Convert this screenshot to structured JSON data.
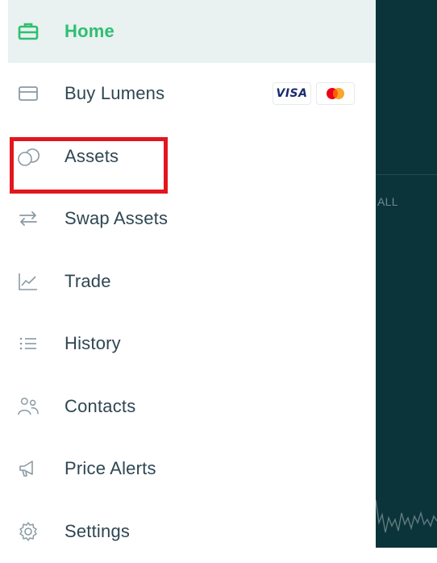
{
  "nav": {
    "items": [
      {
        "key": "home",
        "label": "Home",
        "icon": "briefcase-icon",
        "active": true
      },
      {
        "key": "buy-lumens",
        "label": "Buy Lumens",
        "icon": "card-icon",
        "active": false
      },
      {
        "key": "assets",
        "label": "Assets",
        "icon": "assets-circles-icon",
        "active": false
      },
      {
        "key": "swap-assets",
        "label": "Swap Assets",
        "icon": "swap-arrows-icon",
        "active": false
      },
      {
        "key": "trade",
        "label": "Trade",
        "icon": "line-chart-icon",
        "active": false
      },
      {
        "key": "history",
        "label": "History",
        "icon": "list-icon",
        "active": false
      },
      {
        "key": "contacts",
        "label": "Contacts",
        "icon": "contacts-icon",
        "active": false
      },
      {
        "key": "price-alerts",
        "label": "Price Alerts",
        "icon": "megaphone-icon",
        "active": false
      },
      {
        "key": "settings",
        "label": "Settings",
        "icon": "gear-icon",
        "active": false
      }
    ],
    "payment_badges": {
      "visa": "VISA",
      "mastercard": "mastercard-icon"
    }
  },
  "backdrop": {
    "range_label": "ALL"
  },
  "colors": {
    "accent": "#2fbf6f",
    "active_bg": "#e9f1f1",
    "text": "#2f4653",
    "icon": "#8a9aa3",
    "backdrop": "#0b343a",
    "highlight": "#e3151e"
  }
}
